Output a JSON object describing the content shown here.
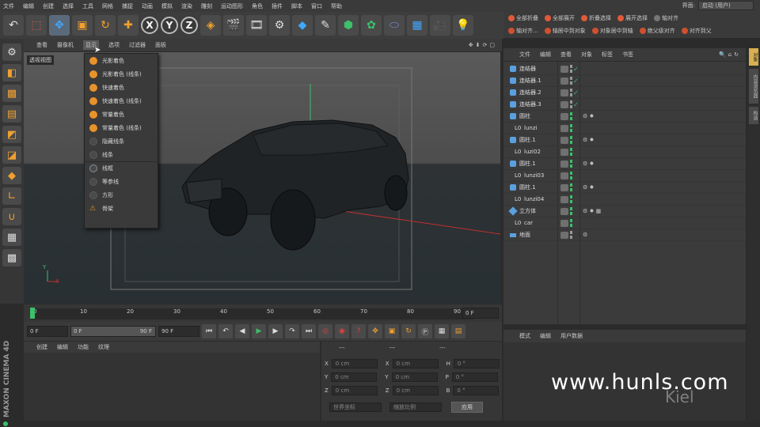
{
  "menubar": {
    "items": [
      "文件",
      "编辑",
      "创建",
      "选择",
      "工具",
      "网格",
      "捕捉",
      "动画",
      "模拟",
      "渲染",
      "雕刻",
      "运动图形",
      "角色",
      "插件",
      "脚本",
      "窗口",
      "帮助"
    ],
    "layout_label": "界面:",
    "layout_value": "启动 (用户)"
  },
  "toolbar": {
    "icons": [
      "undo-icon",
      "live-select-icon",
      "move-icon",
      "scale-icon",
      "rotate-icon",
      "add-icon",
      "x-axis",
      "y-axis",
      "z-axis",
      "coord-system",
      "render-view",
      "render-picture",
      "render-settings",
      "cube",
      "pen",
      "subdivision",
      "array",
      "deformer",
      "floor",
      "camera",
      "light"
    ],
    "xyz": [
      "X",
      "Y",
      "Z"
    ]
  },
  "viewport_menu": {
    "items": [
      "查看",
      "摄像机",
      "显示",
      "选项",
      "过滤器",
      "面板"
    ],
    "active": "显示",
    "label": "透视视图"
  },
  "display_dropdown": {
    "items": [
      {
        "label": "光影着色",
        "dim": false
      },
      {
        "label": "光影着色 (线条)",
        "dim": false
      },
      {
        "label": "快速着色",
        "dim": false
      },
      {
        "label": "快速着色 (线条)",
        "dim": false
      },
      {
        "label": "常量着色",
        "dim": false
      },
      {
        "label": "常量着色 (线条)",
        "dim": false
      },
      {
        "label": "隐藏线条",
        "dim": true
      },
      {
        "label": "线条",
        "dim": true
      },
      {
        "label": "线框",
        "dim": false,
        "sep": true
      },
      {
        "label": "等参线",
        "dim": true
      },
      {
        "label": "方形",
        "dim": true
      },
      {
        "label": "骨架",
        "dim": true
      }
    ]
  },
  "timeline": {
    "ticks": [
      "0",
      "10",
      "20",
      "30",
      "40",
      "50",
      "60",
      "70",
      "80",
      "90"
    ],
    "current_frame": "0 F"
  },
  "playback": {
    "start": "0 F",
    "range_start": "0 F",
    "range_end": "90 F",
    "end": "90 F"
  },
  "material_menu": [
    "创建",
    "编辑",
    "功能",
    "纹理"
  ],
  "coordinates": {
    "headers": [
      "---",
      "---",
      "---"
    ],
    "rows": [
      {
        "a": "X",
        "av": "0 cm",
        "b": "X",
        "bv": "0 cm",
        "c": "H",
        "cv": "0 °"
      },
      {
        "a": "Y",
        "av": "0 cm",
        "b": "Y",
        "bv": "0 cm",
        "c": "P",
        "cv": "0 °"
      },
      {
        "a": "Z",
        "av": "0 cm",
        "b": "Z",
        "bv": "0 cm",
        "c": "B",
        "cv": "0 °"
      }
    ],
    "mode1": "世界坐标",
    "mode2": "缩放比例",
    "apply": "应用"
  },
  "right_top": {
    "row1": [
      "全部折叠",
      "全部展开",
      "折叠选择",
      "展开选择",
      "轴对齐"
    ],
    "row2": [
      "轴对齐...",
      "轴居中到对象",
      "对象居中到轴",
      "绝父级对齐",
      "对齐到父"
    ]
  },
  "object_menu": [
    "文件",
    "编辑",
    "查看",
    "对象",
    "标签",
    "书签"
  ],
  "objects": [
    {
      "name": "连结器",
      "indent": 0,
      "icon": "blue",
      "tags": "chk"
    },
    {
      "name": "连结器.1",
      "indent": 0,
      "icon": "blue",
      "tags": "chk"
    },
    {
      "name": "连结器.2",
      "indent": 0,
      "icon": "blue",
      "tags": "chk"
    },
    {
      "name": "连结器.3",
      "indent": 0,
      "icon": "blue",
      "tags": "chk"
    },
    {
      "name": "圆柱",
      "indent": 0,
      "icon": "blue",
      "tags": "mat"
    },
    {
      "name": "lunzi",
      "indent": 1,
      "icon": "L0",
      "tags": ""
    },
    {
      "name": "圆柱.1",
      "indent": 0,
      "icon": "blue",
      "tags": "mat"
    },
    {
      "name": "luzi02",
      "indent": 1,
      "icon": "L0",
      "tags": ""
    },
    {
      "name": "圆柱.1",
      "indent": 0,
      "icon": "blue",
      "tags": "mat"
    },
    {
      "name": "lunzi03",
      "indent": 1,
      "icon": "L0",
      "tags": ""
    },
    {
      "name": "圆柱.1",
      "indent": 0,
      "icon": "blue",
      "tags": "mat"
    },
    {
      "name": "lunzi04",
      "indent": 1,
      "icon": "L0",
      "tags": ""
    },
    {
      "name": "立方体",
      "indent": 0,
      "icon": "cube",
      "tags": "mat2"
    },
    {
      "name": "car",
      "indent": 1,
      "icon": "L0",
      "tags": ""
    },
    {
      "name": "地面",
      "indent": 0,
      "icon": "floor",
      "tags": "mat3"
    }
  ],
  "attr_menu": [
    "模式",
    "编辑",
    "用户数据"
  ],
  "side_tabs": [
    "对象",
    "内容浏览器",
    "构造"
  ],
  "cinema_logo": "MAXON CINEMA 4D",
  "watermark": "www.hunls.com",
  "watermark2": "Kiel",
  "axis_y": "Y",
  "axis_x": "X"
}
